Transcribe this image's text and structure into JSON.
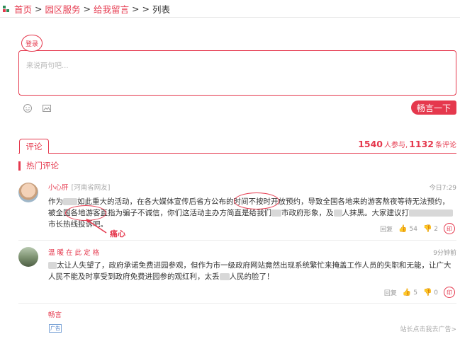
{
  "breadcrumb": {
    "items": [
      "首页",
      "园区服务",
      "给我留言"
    ],
    "separator": ">",
    "current": "列表"
  },
  "comment_box": {
    "login_label": "登录",
    "placeholder": "来说两句吧...",
    "emoji_icon": "smile-icon",
    "image_icon": "image-icon",
    "submit_label": "畅言一下"
  },
  "tabs": {
    "active": "评论"
  },
  "stats": {
    "participants": "1540",
    "participants_label": "人参与,",
    "comments": "1132",
    "comments_label": "条评论"
  },
  "hot_title": "热门评论",
  "comments": [
    {
      "user": "小心肝",
      "location": "[河南省网友]",
      "time": "今日7:29",
      "text_parts": [
        "作为",
        "如此重大的活动，在各大媒体宣传后省方公布的时间不按时开放预约，导致全国各地来的游客熬夜等待无法预约，被全国各地游客直指为",
        "骗子不诚信",
        "，你们这活动主办方简直是给我们",
        "市政府形象，及",
        "人抹黑。大家建议打",
        "市长热线投诉吧。"
      ],
      "reply_label": "回复",
      "likes": "54",
      "dislikes": "2",
      "share_label": "印"
    },
    {
      "user": "温 暖 在 此 定 格",
      "location": "",
      "time": "9分钟前",
      "text_parts": [
        "太让人失望了，政府承诺免费进园参观，但作为市一级政府网站竟然出现系统繁忙来掩盖工作人员的失职和无能，让广大人民不能及时享受到政府免费进园参的观红利，太丢",
        "人民的脸了！"
      ],
      "reply_label": "回复",
      "likes": "5",
      "dislikes": "0",
      "share_label": "印"
    }
  ],
  "annotation": {
    "label": "痛心"
  },
  "ad": {
    "user": "畅言",
    "tag": "广告",
    "link": "站长点击我去广告>"
  },
  "colors": {
    "accent": "#e5384d",
    "muted": "#999999",
    "border": "#eeeeee"
  }
}
